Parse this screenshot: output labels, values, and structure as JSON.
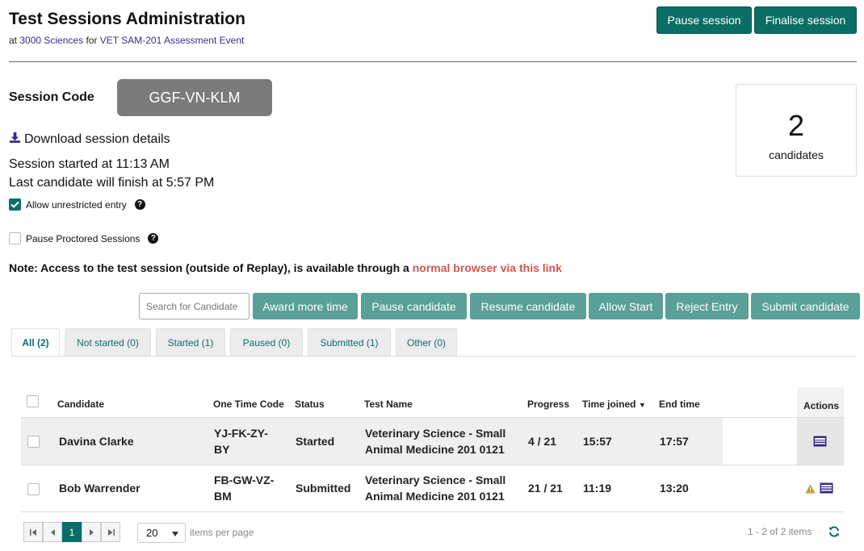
{
  "header": {
    "title": "Test Sessions Administration",
    "at": "at",
    "org": "3000 Sciences",
    "for": "for",
    "event": "VET SAM-201 Assessment Event",
    "pause_session": "Pause session",
    "finalise_session": "Finalise session"
  },
  "session": {
    "code_label": "Session Code",
    "code": "GGF-VN-KLM",
    "candidate_count": "2",
    "candidate_count_label": "candidates",
    "download": "Download session details",
    "started": "Session started at 11:13 AM",
    "finish": "Last candidate will finish at 5:57 PM",
    "allow_unrestricted": "Allow unrestricted entry",
    "allow_unrestricted_checked": true,
    "pause_proctored": "Pause Proctored Sessions",
    "pause_proctored_checked": false
  },
  "note": {
    "text": "Note: Access to the test session (outside of Replay), is available through a",
    "link": "normal browser via this link"
  },
  "toolbar": {
    "search_placeholder": "Search for Candidate",
    "award": "Award more time",
    "pause": "Pause candidate",
    "resume": "Resume candidate",
    "allow": "Allow Start",
    "reject": "Reject Entry",
    "submit": "Submit candidate"
  },
  "tabs": [
    {
      "label": "All (2)"
    },
    {
      "label": "Not started (0)"
    },
    {
      "label": "Started (1)"
    },
    {
      "label": "Paused (0)"
    },
    {
      "label": "Submitted (1)"
    },
    {
      "label": "Other (0)"
    }
  ],
  "table": {
    "headers": {
      "candidate": "Candidate",
      "code": "One Time Code",
      "status": "Status",
      "test": "Test Name",
      "progress": "Progress",
      "joined": "Time joined",
      "sort_arrow": "▼",
      "end": "End time",
      "actions": "Actions"
    },
    "rows": [
      {
        "candidate": "Davina Clarke",
        "code1": "YJ-FK-ZY-",
        "code2": "BY",
        "status": "Started",
        "test1": "Veterinary Science - Small",
        "test2": "Animal Medicine 201 0121",
        "progress": "4 / 21",
        "joined": "15:57",
        "end": "17:57"
      },
      {
        "candidate": "Bob Warrender",
        "code1": "FB-GW-VZ-",
        "code2": "BM",
        "status": "Submitted",
        "test1": "Veterinary Science - Small",
        "test2": "Animal Medicine 201 0121",
        "progress": "21 / 21",
        "joined": "11:19",
        "end": "13:20"
      }
    ]
  },
  "pager": {
    "current_page": "1",
    "page_size": "20",
    "items_per_page": "items per page",
    "summary": "1 - 2 of 2 items"
  },
  "colors": {
    "primary": "#0b6e66",
    "button": "#5a9f98",
    "link_red": "#d9534f",
    "link_purple": "#3a2a8c",
    "icon_purple": "#3a2a8c",
    "warning": "#c8962e"
  }
}
